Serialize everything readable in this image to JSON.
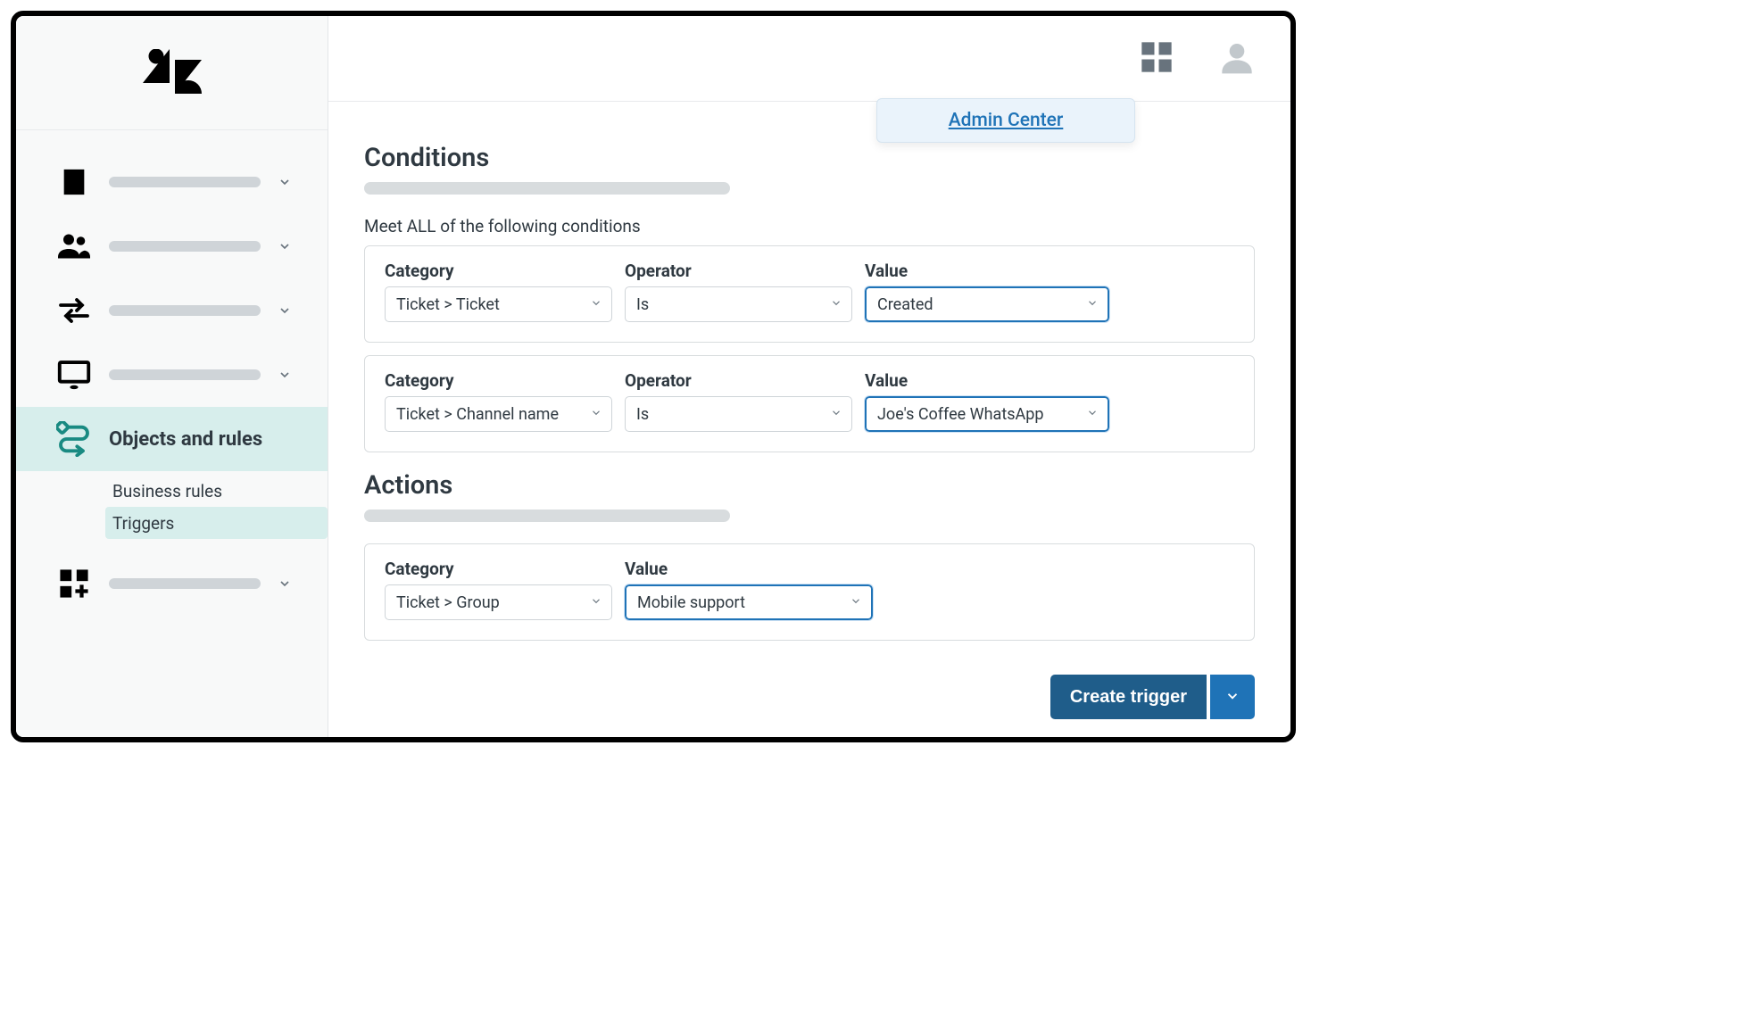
{
  "header": {
    "admin_center_link": "Admin Center"
  },
  "sidebar": {
    "active_label": "Objects and rules",
    "subnav": {
      "business_rules": "Business rules",
      "triggers": "Triggers"
    }
  },
  "conditions": {
    "title": "Conditions",
    "meet_all_label": "Meet ALL of the following conditions",
    "labels": {
      "category": "Category",
      "operator": "Operator",
      "value": "Value"
    },
    "rows": [
      {
        "category": "Ticket > Ticket",
        "operator": "Is",
        "value": "Created"
      },
      {
        "category": "Ticket > Channel name",
        "operator": "Is",
        "value": "Joe's Coffee WhatsApp"
      }
    ]
  },
  "actions": {
    "title": "Actions",
    "labels": {
      "category": "Category",
      "value": "Value"
    },
    "row": {
      "category": "Ticket > Group",
      "value": "Mobile support"
    }
  },
  "buttons": {
    "create_trigger": "Create trigger"
  }
}
